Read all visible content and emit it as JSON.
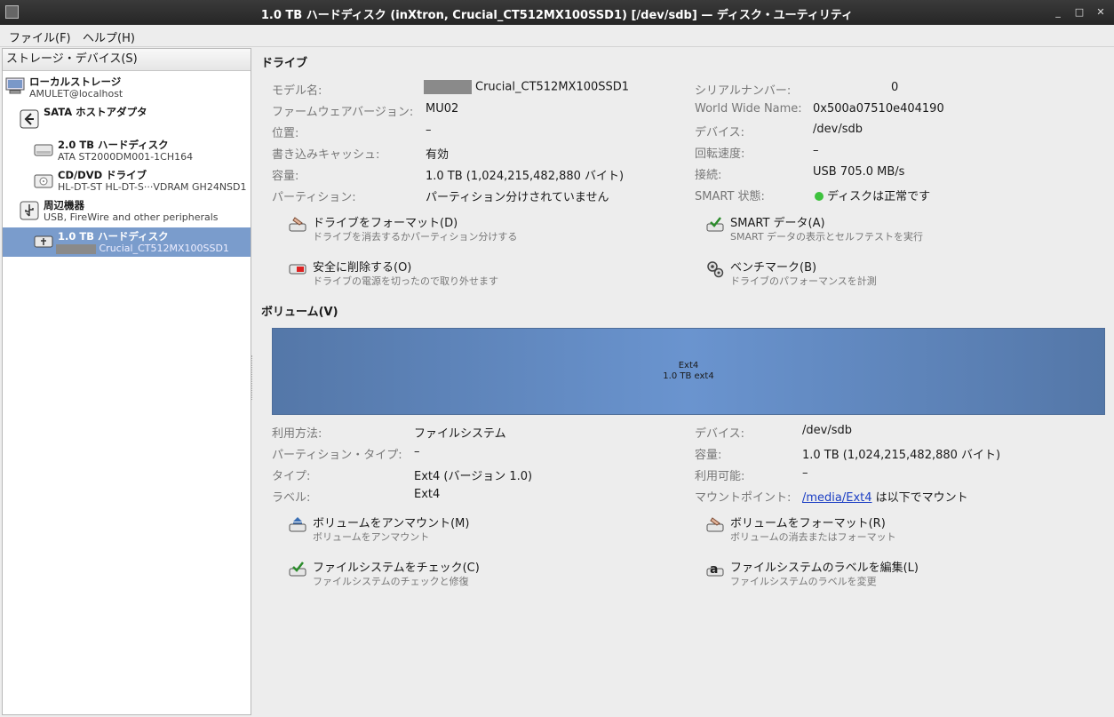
{
  "window": {
    "title": "1.0 TB ハードディスク (inXtron, Crucial_CT512MX100SSD1) [/dev/sdb] — ディスク・ユーティリティ",
    "minimize": "_",
    "maximize": "□",
    "close": "✕"
  },
  "menu": {
    "file": "ファイル(F)",
    "help": "ヘルプ(H)"
  },
  "sidebar": {
    "header": "ストレージ・デバイス(S)",
    "items": [
      {
        "title": "ローカルストレージ",
        "subtitle": "AMULET@localhost",
        "icon": "computer-icon"
      },
      {
        "title": "SATA ホストアダプタ",
        "subtitle": "",
        "icon": "host-adapter-icon"
      },
      {
        "title": "2.0 TB ハードディスク",
        "subtitle": "ATA ST2000DM001-1CH164",
        "icon": "harddisk-icon"
      },
      {
        "title": "CD/DVD ドライブ",
        "subtitle": "HL-DT-ST HL-DT-S···VDRAM GH24NSD1",
        "icon": "optical-drive-icon"
      },
      {
        "title": "周辺機器",
        "subtitle": "USB, FireWire and other peripherals",
        "icon": "peripherals-icon"
      },
      {
        "title": "1.0 TB ハードディスク",
        "subtitle": "Crucial_CT512MX100SSD1",
        "icon": "usb-disk-icon",
        "selected": true
      }
    ]
  },
  "drive": {
    "section_title": "ドライブ",
    "left": [
      {
        "label": "モデル名:",
        "value": "Crucial_CT512MX100SSD1"
      },
      {
        "label": "ファームウェアバージョン:",
        "value": "MU02"
      },
      {
        "label": "位置:",
        "value": "–"
      },
      {
        "label": "書き込みキャッシュ:",
        "value": "有効"
      },
      {
        "label": "容量:",
        "value": "1.0 TB (1,024,215,482,880 バイト)"
      },
      {
        "label": "パーティション:",
        "value": "パーティション分けされていません"
      }
    ],
    "right": [
      {
        "label": "シリアルナンバー:",
        "value": "0"
      },
      {
        "label": "World Wide Name:",
        "value": "0x500a07510e404190"
      },
      {
        "label": "デバイス:",
        "value": "/dev/sdb"
      },
      {
        "label": "回転速度:",
        "value": "–"
      },
      {
        "label": "接続:",
        "value": "USB 705.0 MB/s"
      },
      {
        "label": "SMART 状態:",
        "value": "ディスクは正常です"
      }
    ],
    "actions": [
      {
        "title": "ドライブをフォーマット(D)",
        "subtitle": "ドライブを消去するかパーティション分けする"
      },
      {
        "title": "SMART データ(A)",
        "subtitle": "SMART データの表示とセルフテストを実行"
      },
      {
        "title": "安全に削除する(O)",
        "subtitle": "ドライブの電源を切ったので取り外せます"
      },
      {
        "title": "ベンチマーク(B)",
        "subtitle": "ドライブのパフォーマンスを計測"
      }
    ]
  },
  "volume": {
    "section_title": "ボリューム(V)",
    "bar_line1": "Ext4",
    "bar_line2": "1.0 TB ext4",
    "left": [
      {
        "label": "利用方法:",
        "value": "ファイルシステム"
      },
      {
        "label": "パーティション・タイプ:",
        "value": "–"
      },
      {
        "label": "タイプ:",
        "value": "Ext4 (バージョン 1.0)"
      },
      {
        "label": "ラベル:",
        "value": "Ext4"
      }
    ],
    "right": [
      {
        "label": "デバイス:",
        "value": "/dev/sdb"
      },
      {
        "label": "容量:",
        "value": "1.0 TB (1,024,215,482,880 バイト)"
      },
      {
        "label": "利用可能:",
        "value": "–"
      },
      {
        "label": "マウントポイント:",
        "value_link": "/media/Ext4",
        "value_suffix": " は以下でマウント"
      }
    ],
    "actions": [
      {
        "title": "ボリュームをアンマウント(M)",
        "subtitle": "ボリュームをアンマウント"
      },
      {
        "title": "ボリュームをフォーマット(R)",
        "subtitle": "ボリュームの消去またはフォーマット"
      },
      {
        "title": "ファイルシステムをチェック(C)",
        "subtitle": "ファイルシステムのチェックと修復"
      },
      {
        "title": "ファイルシステムのラベルを編集(L)",
        "subtitle": "ファイルシステムのラベルを変更"
      }
    ]
  }
}
